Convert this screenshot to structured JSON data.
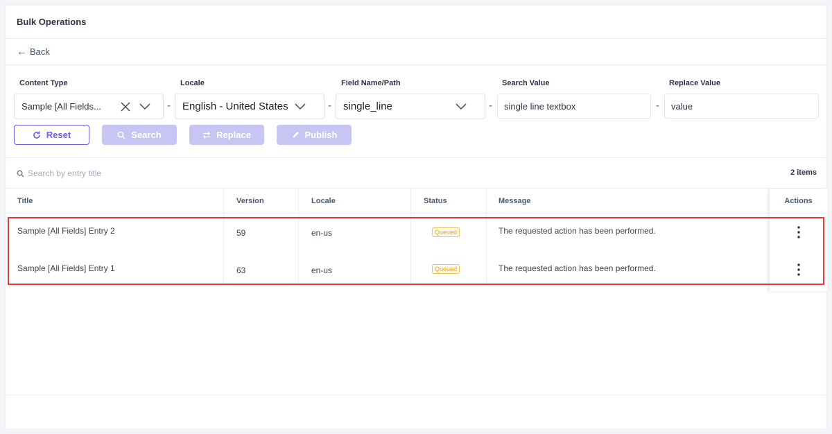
{
  "header": {
    "title": "Bulk Operations"
  },
  "nav": {
    "back_label": "Back"
  },
  "filters": {
    "content_type": {
      "label": "Content Type",
      "value": "Sample [All Fields..."
    },
    "locale": {
      "label": "Locale",
      "value": "English - United States"
    },
    "field": {
      "label": "Field Name/Path",
      "value": "single_line"
    },
    "search_value": {
      "label": "Search Value",
      "value": "single line textbox"
    },
    "replace_value": {
      "label": "Replace Value",
      "value": "value"
    },
    "separator": "-"
  },
  "buttons": {
    "reset": "Reset",
    "search": "Search",
    "replace": "Replace",
    "publish": "Publish"
  },
  "list": {
    "search_placeholder": "Search by entry title",
    "count": "2 items"
  },
  "table": {
    "columns": {
      "title": "Title",
      "version": "Version",
      "locale": "Locale",
      "status": "Status",
      "message": "Message",
      "actions": "Actions"
    },
    "rows": [
      {
        "title": "Sample [All Fields] Entry 2",
        "version": "59",
        "locale": "en-us",
        "status": "Queued",
        "message": "The requested action has been performed."
      },
      {
        "title": "Sample [All Fields] Entry 1",
        "version": "63",
        "locale": "en-us",
        "status": "Queued",
        "message": "The requested action has been performed."
      }
    ]
  },
  "colors": {
    "accent": "#6c5ce7",
    "accent_disabled": "#c8c4f3",
    "status_queued": "#e8a317",
    "highlight": "#e53935"
  },
  "icons": {
    "back": "arrow-left-icon",
    "clear": "close-icon",
    "dropdown": "chevron-down-icon",
    "reset": "refresh-icon",
    "search": "search-icon",
    "replace": "swap-icon",
    "publish": "publish-icon",
    "more": "more-vertical-icon"
  }
}
